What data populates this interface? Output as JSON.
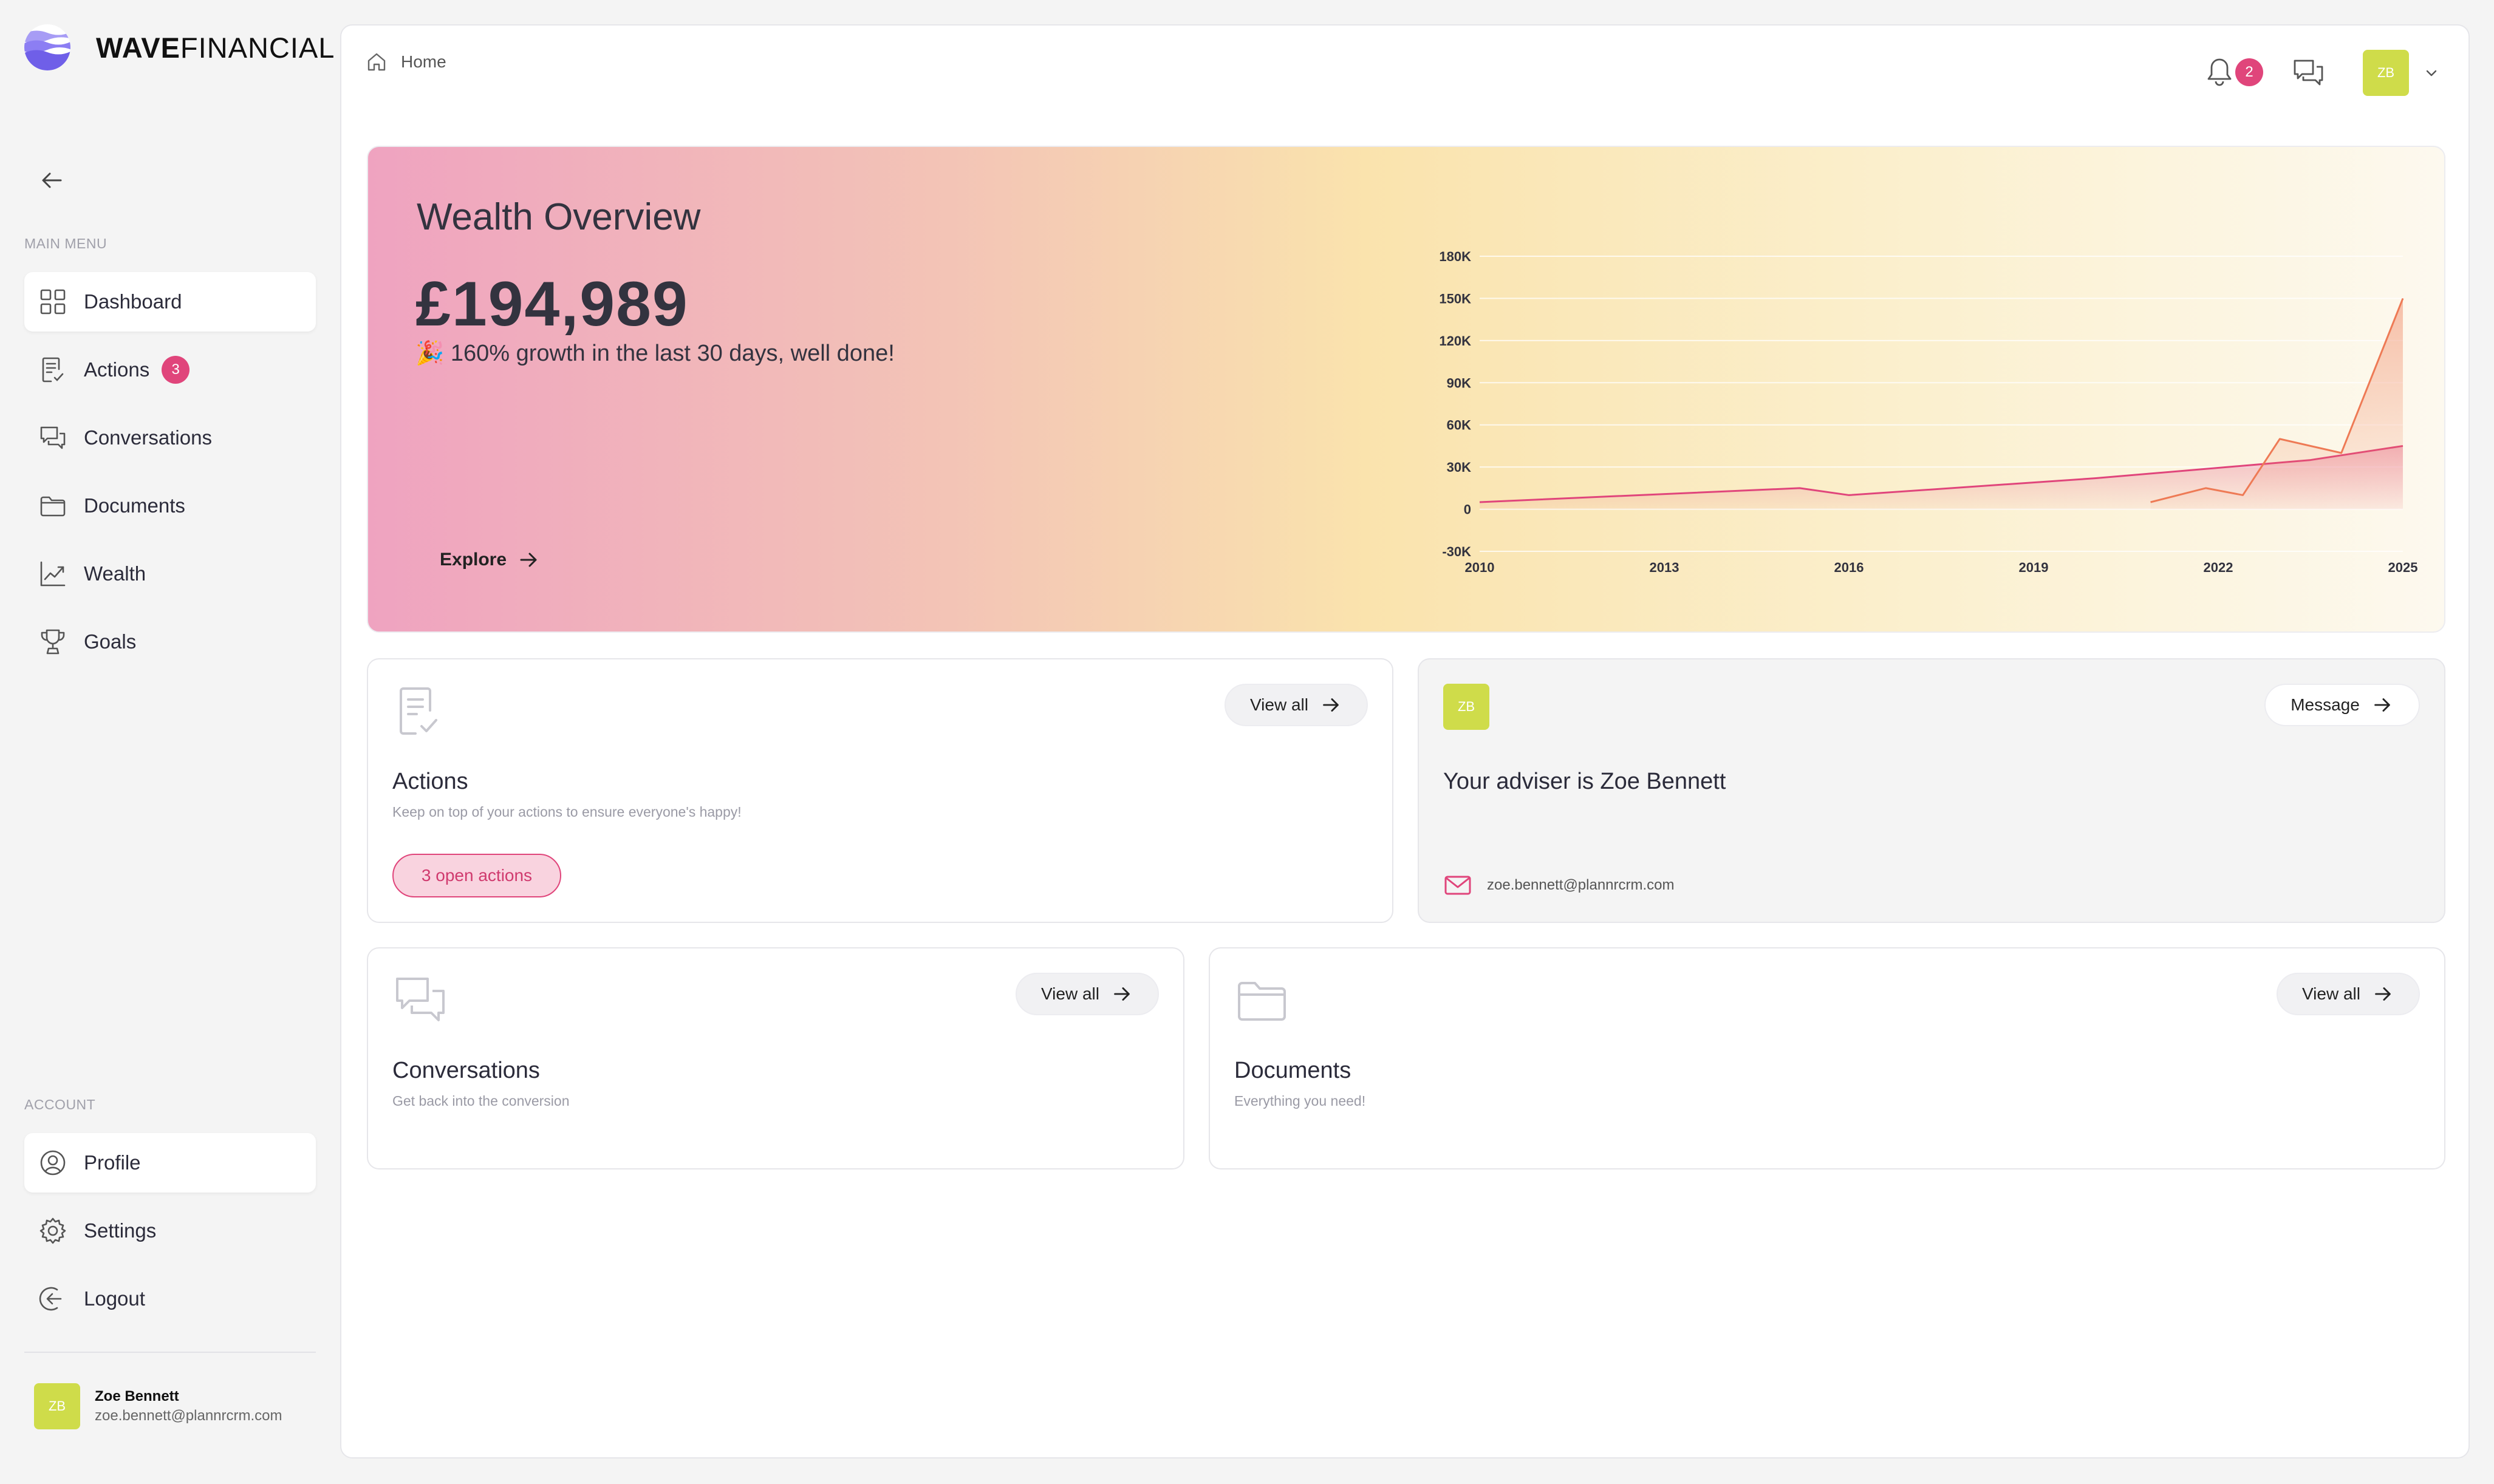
{
  "brand": {
    "name_bold": "WAVE",
    "name_light": "FINANCIAL",
    "color": "#7c6ef2"
  },
  "sidebar": {
    "main_menu_label": "MAIN MENU",
    "items": [
      {
        "label": "Dashboard",
        "icon": "grid-icon",
        "active": true
      },
      {
        "label": "Actions",
        "icon": "checklist-icon",
        "badge": "3"
      },
      {
        "label": "Conversations",
        "icon": "chat-icon"
      },
      {
        "label": "Documents",
        "icon": "folder-icon"
      },
      {
        "label": "Wealth",
        "icon": "trend-icon"
      },
      {
        "label": "Goals",
        "icon": "trophy-icon"
      }
    ],
    "account_label": "ACCOUNT",
    "account_items": [
      {
        "label": "Profile",
        "icon": "profile-icon",
        "active": true
      },
      {
        "label": "Settings",
        "icon": "gear-icon"
      },
      {
        "label": "Logout",
        "icon": "logout-icon"
      }
    ],
    "user": {
      "initials": "ZB",
      "name": "Zoe Bennett",
      "email": "zoe.bennett@plannrcrm.com"
    }
  },
  "header": {
    "breadcrumb": "Home",
    "notifications_count": "2",
    "avatar_initials": "ZB"
  },
  "hero": {
    "title": "Wealth Overview",
    "value": "£194,989",
    "growth_emoji": "🎉",
    "growth_text": "160% growth in the last 30 days, well done!",
    "explore_label": "Explore"
  },
  "chart_data": {
    "type": "area",
    "title": "",
    "xlabel": "",
    "ylabel": "",
    "x_ticks": [
      "2010",
      "2013",
      "2016",
      "2019",
      "2022",
      "2025"
    ],
    "y_ticks": [
      "180K",
      "150K",
      "120K",
      "90K",
      "60K",
      "30K",
      "0",
      "-30K"
    ],
    "ylim": [
      -30000,
      180000
    ],
    "xlim": [
      2010,
      2025
    ],
    "grid": true,
    "series": [
      {
        "color": "#e0457b",
        "points": [
          [
            2010,
            5000
          ],
          [
            2015.2,
            15000
          ],
          [
            2016,
            10000
          ],
          [
            2020,
            22000
          ],
          [
            2023.5,
            35000
          ],
          [
            2025,
            45000
          ]
        ]
      },
      {
        "color": "#ee7a55",
        "points": [
          [
            2020.9,
            5000
          ],
          [
            2021.8,
            15000
          ],
          [
            2022.4,
            10000
          ],
          [
            2023,
            50000
          ],
          [
            2024,
            40000
          ],
          [
            2025,
            150000
          ]
        ]
      }
    ]
  },
  "actions_card": {
    "title": "Actions",
    "subtitle": "Keep on top of your actions to ensure everyone's happy!",
    "view_all": "View all",
    "open_actions": "3 open actions"
  },
  "adviser_card": {
    "initials": "ZB",
    "title": "Your adviser is Zoe Bennett",
    "message_label": "Message",
    "email": "zoe.bennett@plannrcrm.com"
  },
  "conversations_card": {
    "title": "Conversations",
    "subtitle": "Get back into the conversion",
    "view_all": "View all"
  },
  "documents_card": {
    "title": "Documents",
    "subtitle": "Everything you need!",
    "view_all": "View all"
  }
}
